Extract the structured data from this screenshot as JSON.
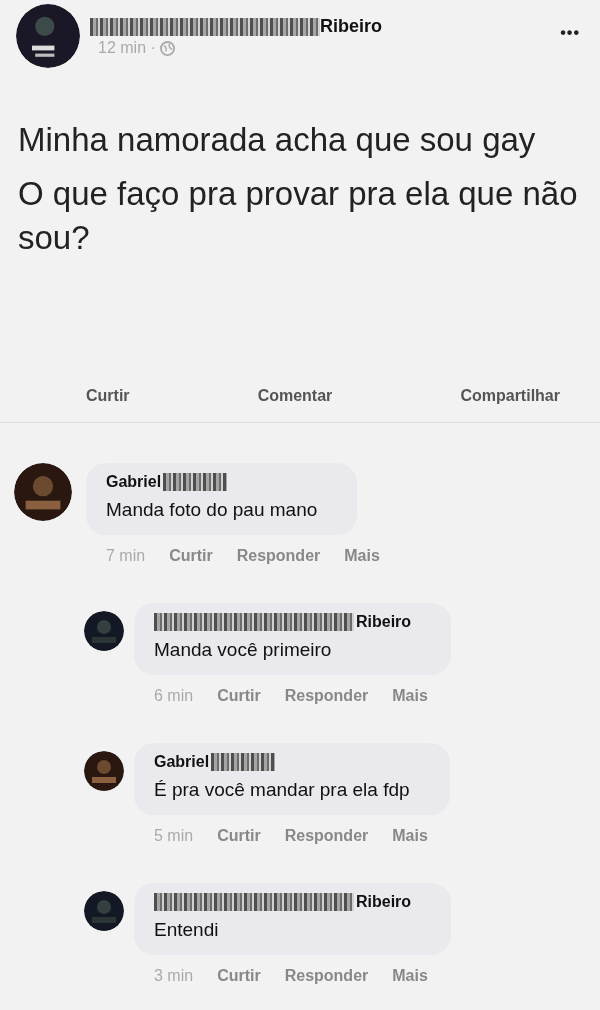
{
  "post": {
    "author": "Ribeiro",
    "time": "12 min ·",
    "text": [
      "Minha namorada acha que sou gay",
      "O que faço pra provar pra ela que não sou?"
    ],
    "menu": "•••"
  },
  "actions": [
    "Curtir",
    "Comentar",
    "Compartilhar"
  ],
  "comments": [
    {
      "author": "Gabriel",
      "reply": false,
      "text": "Manda foto do pau mano",
      "time": "7 min",
      "actions": [
        "Curtir",
        "Responder",
        "Mais"
      ]
    },
    {
      "author": "Ribeiro",
      "reply": true,
      "text": "Manda você primeiro",
      "time": "6 min",
      "actions": [
        "Curtir",
        "Responder",
        "Mais"
      ]
    },
    {
      "author": "Gabriel",
      "reply": true,
      "text": "É pra você mandar pra ela fdp",
      "time": "5 min",
      "actions": [
        "Curtir",
        "Responder",
        "Mais"
      ]
    },
    {
      "author": "Ribeiro",
      "reply": true,
      "text": "Entendi",
      "time": "3 min",
      "actions": [
        "Curtir",
        "Responder",
        "Mais"
      ]
    }
  ]
}
